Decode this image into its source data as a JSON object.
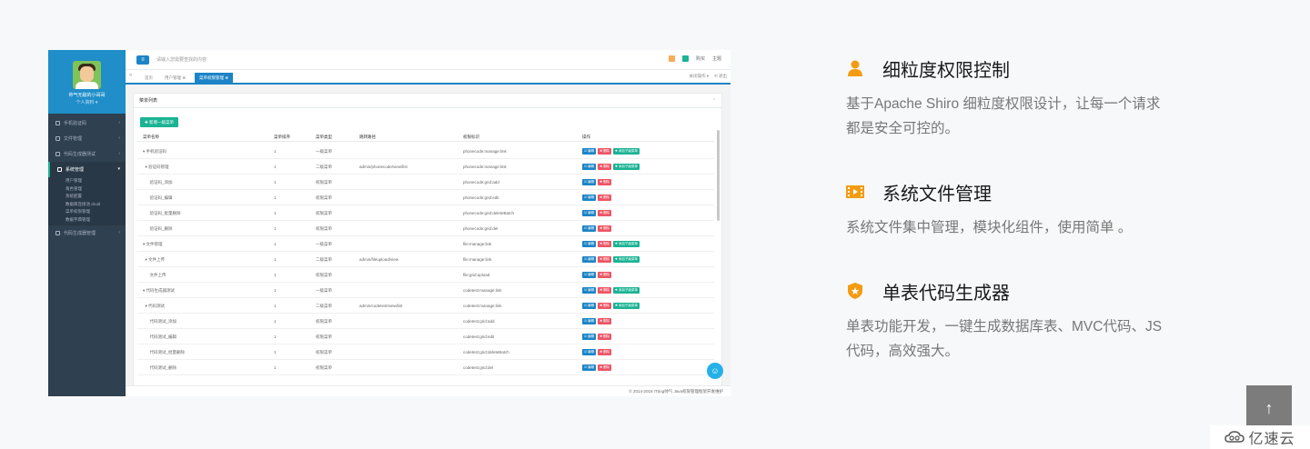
{
  "screenshot": {
    "sidebar": {
      "user_name": "帅气无敌的小哥哥",
      "user_sub": "个人资料 ▾",
      "menu": [
        {
          "label": "手机验证码",
          "active": false
        },
        {
          "label": "文件管理",
          "active": false
        },
        {
          "label": "代码生成器测试",
          "active": false
        },
        {
          "label": "系统管理",
          "active": true
        }
      ],
      "submenu": [
        "用户管理",
        "角色管理",
        "系统配置",
        "数据库连接池 druid",
        "菜单权限管理",
        "数据字典管理"
      ],
      "menu_bottom": {
        "label": "代码生成器管理"
      }
    },
    "topbar": {
      "search_placeholder": "请输入您需要查找的内容",
      "account_label": "购买",
      "home_label": "主题"
    },
    "tabs": [
      {
        "label": "首页",
        "active": false
      },
      {
        "label": "用户管理 ⊗",
        "active": false
      },
      {
        "label": "菜单权限管理 ⊗",
        "active": true
      }
    ],
    "tab_tools": [
      "关闭操作 ▾",
      "⟲ 退出"
    ],
    "panel_title": "菜单列表",
    "add_button": "✚ 新增一级菜单",
    "columns": [
      "菜单名称",
      "菜单排序",
      "菜单类型",
      "跳转路径",
      "权限标识",
      "操作"
    ],
    "rows": [
      {
        "name": "▾ 手机验证码",
        "order": "1",
        "type": "一级菜单",
        "path": "",
        "perm": "phonecode:manage:link",
        "ops": [
          "edit",
          "del",
          "add"
        ]
      },
      {
        "name": "  ▾ 验证码管理",
        "order": "1",
        "type": "二级菜单",
        "path": "admin/phonecode/view/list",
        "perm": "phonecode:manage:link",
        "ops": [
          "edit",
          "del",
          "add"
        ]
      },
      {
        "name": "      验证码_添加",
        "order": "1",
        "type": "权限菜单",
        "path": "",
        "perm": "phonecode:grid:add",
        "ops": [
          "edit",
          "del"
        ]
      },
      {
        "name": "      验证码_编辑",
        "order": "1",
        "type": "权限菜单",
        "path": "",
        "perm": "phonecode:grid:edit",
        "ops": [
          "edit",
          "del"
        ]
      },
      {
        "name": "      验证码_批量删除",
        "order": "1",
        "type": "权限菜单",
        "path": "",
        "perm": "phonecode:grid:deleteBatch",
        "ops": [
          "edit",
          "del"
        ]
      },
      {
        "name": "      验证码_删除",
        "order": "1",
        "type": "权限菜单",
        "path": "",
        "perm": "phonecode:grid:del",
        "ops": [
          "edit",
          "del"
        ]
      },
      {
        "name": "▾ 文件管理",
        "order": "1",
        "type": "一级菜单",
        "path": "",
        "perm": "file:manage:link",
        "ops": [
          "edit",
          "del",
          "add"
        ]
      },
      {
        "name": "  ▾ 文件上传",
        "order": "1",
        "type": "二级菜单",
        "path": "admin/fileupload/view",
        "perm": "file:manage:link",
        "ops": [
          "edit",
          "del",
          "add"
        ]
      },
      {
        "name": "      文件上传",
        "order": "1",
        "type": "权限菜单",
        "path": "",
        "perm": "file:grid:upload",
        "ops": [
          "edit",
          "del"
        ]
      },
      {
        "name": "▾ 代码生成器测试",
        "order": "1",
        "type": "一级菜单",
        "path": "",
        "perm": "codetest:manage:link",
        "ops": [
          "edit",
          "del",
          "add"
        ]
      },
      {
        "name": "  ▾ 代码测试",
        "order": "1",
        "type": "二级菜单",
        "path": "admin/codetest/view/list",
        "perm": "codetest:manage:link",
        "ops": [
          "edit",
          "del",
          "add"
        ]
      },
      {
        "name": "      代码测试_添加",
        "order": "1",
        "type": "权限菜单",
        "path": "",
        "perm": "codetest:grid:add",
        "ops": [
          "edit",
          "del"
        ]
      },
      {
        "name": "      代码测试_编辑",
        "order": "1",
        "type": "权限菜单",
        "path": "",
        "perm": "codetest:grid:edit",
        "ops": [
          "edit",
          "del"
        ]
      },
      {
        "name": "      代码测试_批量删除",
        "order": "1",
        "type": "权限菜单",
        "path": "",
        "perm": "codetest:grid:deleteBatch",
        "ops": [
          "edit",
          "del"
        ]
      },
      {
        "name": "      代码测试_删除",
        "order": "1",
        "type": "权限菜单",
        "path": "",
        "perm": "codetest:grid:del",
        "ops": [
          "edit",
          "del"
        ]
      }
    ],
    "op_labels": {
      "edit": "☑ 编辑",
      "del": "✖ 删除",
      "add": "✚ 添加子级菜单"
    },
    "footer": "© 2014-2018 ITdog帅气 Java权限管理框架开发维护"
  },
  "features": [
    {
      "title": "细粒度权限控制",
      "desc": "基于Apache Shiro 细粒度权限设计，让每一个请求都是安全可控的。",
      "icon": "user-icon",
      "color": "#f39c12"
    },
    {
      "title": "系统文件管理",
      "desc": "系统文件集中管理，模块化组件，使用简单 。",
      "icon": "film-icon",
      "color": "#f39c12"
    },
    {
      "title": "单表代码生成器",
      "desc": "单表功能开发，一键生成数据库表、MVC代码、JS代码，高效强大。",
      "icon": "shield-star-icon",
      "color": "#f39c12"
    }
  ],
  "back_to_top": "↑",
  "brand": {
    "text": "亿速云"
  }
}
